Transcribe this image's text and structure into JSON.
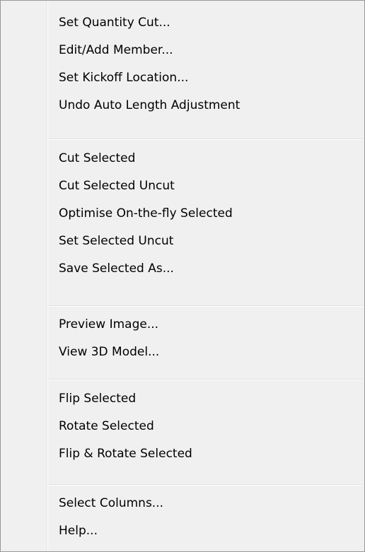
{
  "menu": {
    "groups": [
      {
        "items": [
          {
            "label": "Set Quantity Cut..."
          },
          {
            "label": "Edit/Add Member..."
          },
          {
            "label": "Set Kickoff Location..."
          },
          {
            "label": "Undo Auto Length Adjustment"
          }
        ]
      },
      {
        "items": [
          {
            "label": "Cut Selected"
          },
          {
            "label": "Cut Selected Uncut"
          },
          {
            "label": "Optimise On-the-fly Selected"
          },
          {
            "label": "Set Selected Uncut"
          },
          {
            "label": "Save Selected As..."
          }
        ]
      },
      {
        "items": [
          {
            "label": "Preview Image..."
          },
          {
            "label": "View 3D Model..."
          }
        ]
      },
      {
        "items": [
          {
            "label": "Flip Selected"
          },
          {
            "label": "Rotate Selected"
          },
          {
            "label": "Flip & Rotate Selected"
          }
        ]
      },
      {
        "items": [
          {
            "label": "Select Columns..."
          },
          {
            "label": "Help..."
          }
        ]
      }
    ]
  }
}
